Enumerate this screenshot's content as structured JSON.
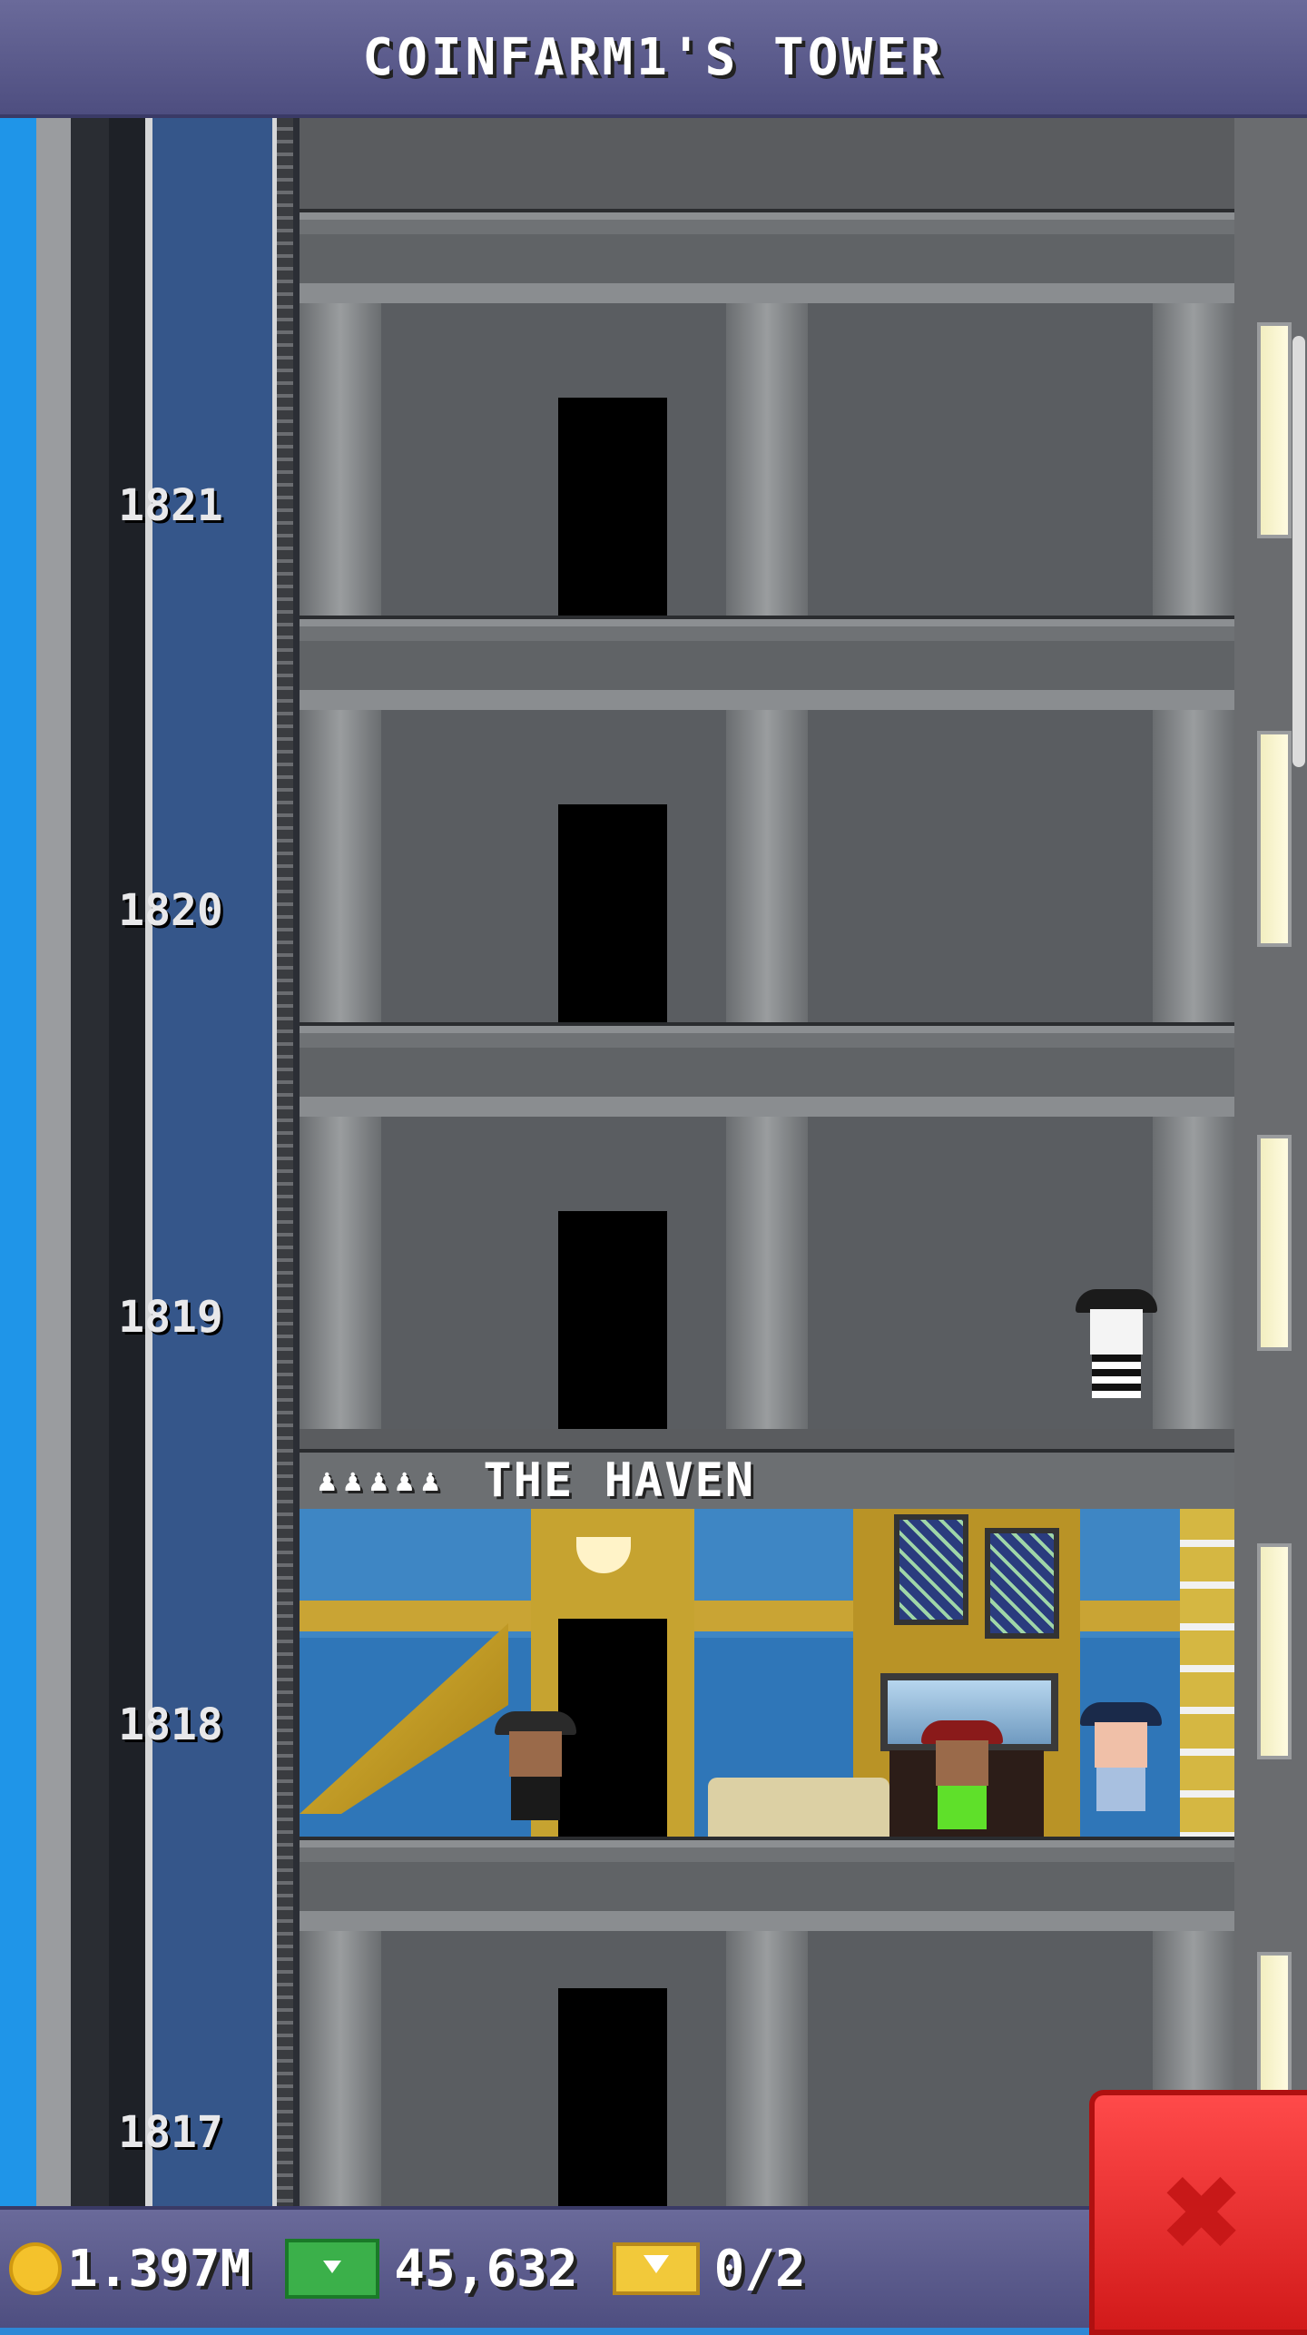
{
  "header": {
    "title": "COINFARM1'S TOWER"
  },
  "tower": {
    "floors": [
      {
        "number": "1821"
      },
      {
        "number": "1820"
      },
      {
        "number": "1819"
      },
      {
        "number": "1818"
      },
      {
        "number": "1817"
      }
    ],
    "haven": {
      "name": "THE HAVEN",
      "occupancy": "♟♟♟♟♟",
      "residents_full": 5
    }
  },
  "status": {
    "coins": "1.397M",
    "bux": "45,632",
    "tickets": "0/2"
  },
  "icons": {
    "coin": "coin-icon",
    "cash": "tower-bux-icon",
    "ticket": "vip-ticket-icon",
    "close": "close-icon"
  },
  "colors": {
    "close_button": "#e02424",
    "bars": "#5a5a8a",
    "sky": "#1f95e8"
  }
}
